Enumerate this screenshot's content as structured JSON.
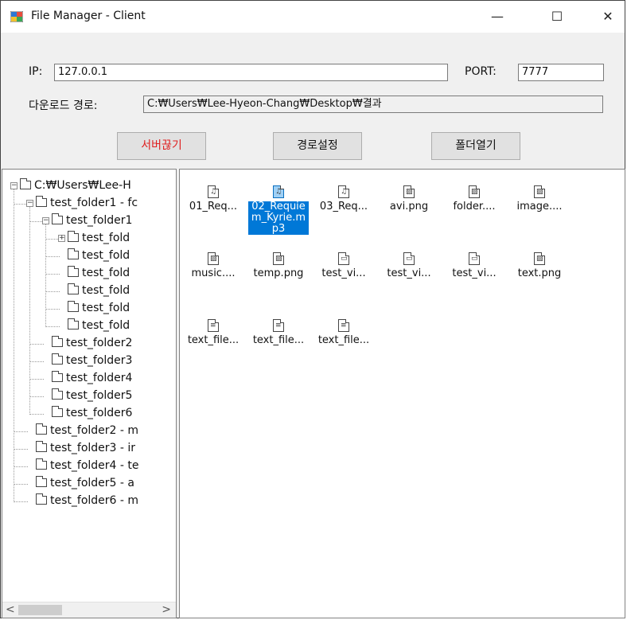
{
  "window": {
    "title": "File Manager - Client",
    "controls": {
      "minimize": "—",
      "maximize": "☐",
      "close": "✕"
    }
  },
  "connection": {
    "ip_label": "IP:",
    "ip_value": "127.0.0.1",
    "port_label": "PORT:",
    "port_value": "7777",
    "download_label": "다운로드 경로:",
    "download_path": "C:₩Users₩Lee-Hyeon-Chang₩Desktop₩결과"
  },
  "buttons": {
    "disconnect": "서버끊기",
    "set_path": "경로설정",
    "open_folder": "폴더열기"
  },
  "tree": {
    "items": [
      {
        "label": "C:₩Users₩Lee-H",
        "level": 0,
        "expander": "−"
      },
      {
        "label": "test_folder1 - fc",
        "level": 1,
        "expander": "−"
      },
      {
        "label": "test_folder1",
        "level": 2,
        "expander": "−"
      },
      {
        "label": "test_fold",
        "level": 3,
        "expander": "+"
      },
      {
        "label": "test_fold",
        "level": 3,
        "expander": ""
      },
      {
        "label": "test_fold",
        "level": 3,
        "expander": ""
      },
      {
        "label": "test_fold",
        "level": 3,
        "expander": ""
      },
      {
        "label": "test_fold",
        "level": 3,
        "expander": ""
      },
      {
        "label": "test_fold",
        "level": 3,
        "expander": ""
      },
      {
        "label": "test_folder2",
        "level": 2,
        "expander": ""
      },
      {
        "label": "test_folder3",
        "level": 2,
        "expander": ""
      },
      {
        "label": "test_folder4",
        "level": 2,
        "expander": ""
      },
      {
        "label": "test_folder5",
        "level": 2,
        "expander": ""
      },
      {
        "label": "test_folder6",
        "level": 2,
        "expander": ""
      },
      {
        "label": "test_folder2 - m",
        "level": 1,
        "expander": ""
      },
      {
        "label": "test_folder3 - ir",
        "level": 1,
        "expander": ""
      },
      {
        "label": "test_folder4 - te",
        "level": 1,
        "expander": ""
      },
      {
        "label": "test_folder5 - a",
        "level": 1,
        "expander": ""
      },
      {
        "label": "test_folder6 - m",
        "level": 1,
        "expander": ""
      }
    ],
    "scroll_left": "<",
    "scroll_right": ">"
  },
  "files": [
    {
      "name": "01_Req...",
      "type": "audio",
      "glyph": "♫",
      "selected": false
    },
    {
      "name": "02_Requiem_Kyrie.mp3",
      "type": "audio",
      "glyph": "♫",
      "selected": true
    },
    {
      "name": "03_Req...",
      "type": "audio",
      "glyph": "♫",
      "selected": false
    },
    {
      "name": "avi.png",
      "type": "image",
      "glyph": "▨",
      "selected": false
    },
    {
      "name": "folder....",
      "type": "image",
      "glyph": "▨",
      "selected": false
    },
    {
      "name": "image....",
      "type": "image",
      "glyph": "▨",
      "selected": false
    },
    {
      "name": "music....",
      "type": "image",
      "glyph": "▨",
      "selected": false
    },
    {
      "name": "temp.png",
      "type": "image",
      "glyph": "▨",
      "selected": false
    },
    {
      "name": "test_vi...",
      "type": "video",
      "glyph": "▭",
      "selected": false
    },
    {
      "name": "test_vi...",
      "type": "video",
      "glyph": "▭",
      "selected": false
    },
    {
      "name": "test_vi...",
      "type": "video",
      "glyph": "▭",
      "selected": false
    },
    {
      "name": "text.png",
      "type": "image",
      "glyph": "▨",
      "selected": false
    },
    {
      "name": "text_file...",
      "type": "text",
      "glyph": "≡",
      "selected": false
    },
    {
      "name": "text_file...",
      "type": "text",
      "glyph": "≡",
      "selected": false
    },
    {
      "name": "text_file...",
      "type": "text",
      "glyph": "≡",
      "selected": false
    }
  ],
  "colors": {
    "accent": "#0078d7",
    "danger_text": "#e02020"
  }
}
